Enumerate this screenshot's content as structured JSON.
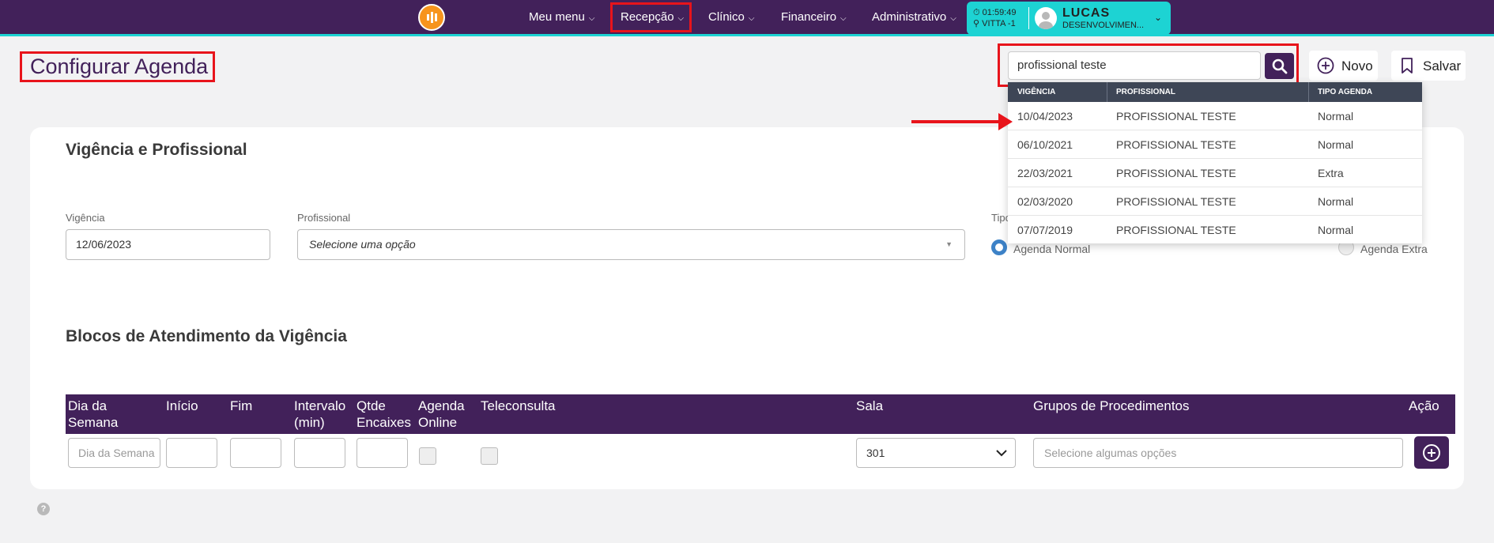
{
  "nav": {
    "items": [
      {
        "label": "Meu menu"
      },
      {
        "label": "Recepção"
      },
      {
        "label": "Clínico"
      },
      {
        "label": "Financeiro"
      },
      {
        "label": "Administrativo"
      }
    ]
  },
  "user": {
    "time": "01:59:49",
    "location": "VITTA -1",
    "name": "LUCAS",
    "role": "DESENVOLVIMEN..."
  },
  "page": {
    "title": "Configurar Agenda"
  },
  "search": {
    "value": "profissional teste"
  },
  "toolbar": {
    "novo_label": "Novo",
    "salvar_label": "Salvar"
  },
  "section1": {
    "title": "Vigência e Profissional",
    "vigencia_label": "Vigência",
    "vigencia_value": "12/06/2023",
    "profissional_label": "Profissional",
    "profissional_placeholder": "Selecione uma opção",
    "tipo_label": "Tipo",
    "radio_normal": "Agenda Normal",
    "radio_extra": "Agenda Extra"
  },
  "section2": {
    "title": "Blocos de Atendimento da Vigência",
    "columns": [
      "Dia da Semana",
      "Início",
      "Fim",
      "Intervalo (min)",
      "Qtde Encaixes",
      "Agenda Online",
      "Teleconsulta",
      "Sala",
      "Grupos de Procedimentos",
      "Ação"
    ],
    "dia_placeholder": "Dia da Semana",
    "sala_value": "301",
    "grupos_placeholder": "Selecione algumas opções"
  },
  "dropdown": {
    "headers": [
      "VIGÊNCIA",
      "PROFISSIONAL",
      "TIPO AGENDA"
    ],
    "rows": [
      {
        "vigencia": "10/04/2023",
        "profissional": "PROFISSIONAL TESTE",
        "tipo": "Normal"
      },
      {
        "vigencia": "06/10/2021",
        "profissional": "PROFISSIONAL TESTE",
        "tipo": "Normal"
      },
      {
        "vigencia": "22/03/2021",
        "profissional": "PROFISSIONAL TESTE",
        "tipo": "Extra"
      },
      {
        "vigencia": "02/03/2020",
        "profissional": "PROFISSIONAL TESTE",
        "tipo": "Normal"
      },
      {
        "vigencia": "07/07/2019",
        "profissional": "PROFISSIONAL TESTE",
        "tipo": "Normal"
      }
    ]
  },
  "colors": {
    "brand": "#42215a",
    "accent": "#1dd3d3",
    "highlight": "#e8141b",
    "logo": "#f7941d"
  },
  "help": {
    "label": "?"
  }
}
